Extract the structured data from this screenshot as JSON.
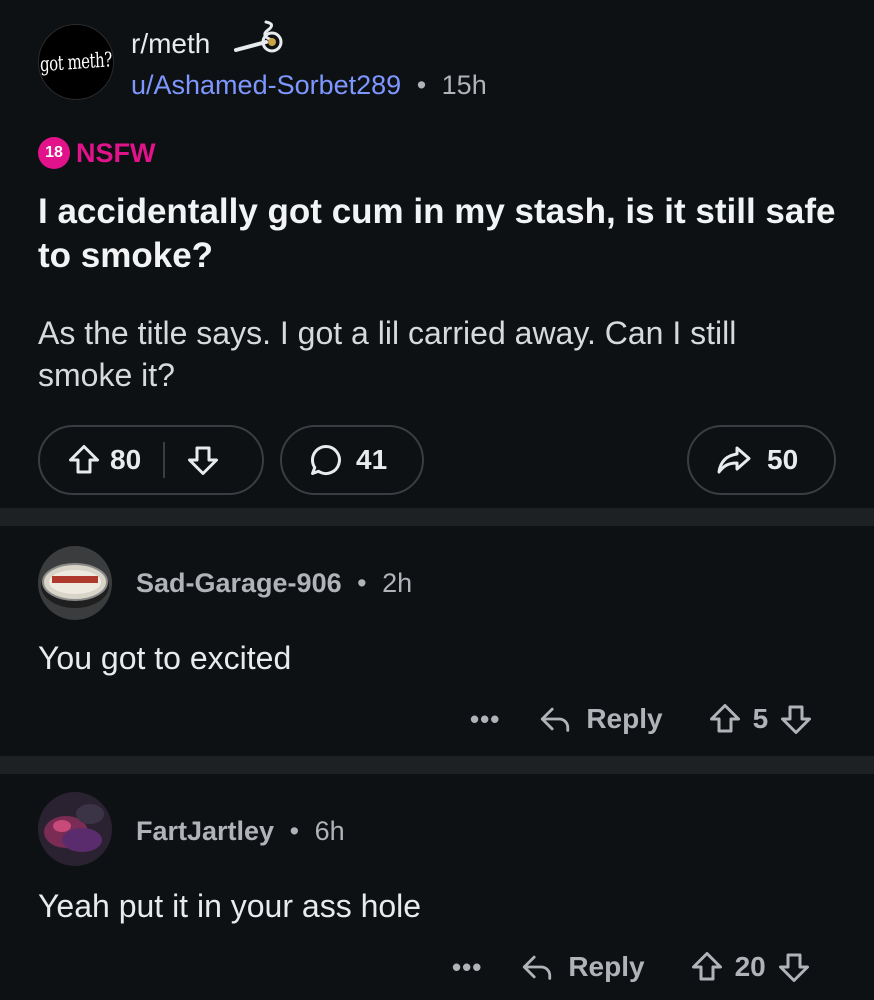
{
  "post": {
    "subreddit": "r/meth",
    "subreddit_avatar_text": "got meth?",
    "author": "u/Ashamed-Sorbet289",
    "separator": "•",
    "age": "15h",
    "nsfw_badge": "18",
    "nsfw_label": "NSFW",
    "title": "I accidentally got cum in my stash, is it still safe to smoke?",
    "body": "As the title says. I got a lil carried away. Can I still smoke it?",
    "upvotes": "80",
    "comments": "41",
    "shares": "50"
  },
  "comments": [
    {
      "username": "Sad-Garage-906",
      "separator": "•",
      "age": "2h",
      "text": "You got to excited",
      "more": "•••",
      "reply_label": "Reply",
      "votes": "5"
    },
    {
      "username": "FartJartley",
      "separator": "•",
      "age": "6h",
      "text": "Yeah put it in your ass hole",
      "more": "•••",
      "reply_label": "Reply",
      "votes": "20"
    }
  ],
  "colors": {
    "background": "#0e1113",
    "divider": "#1e2124",
    "author_link": "#7d97ff",
    "nsfw": "#e1128a",
    "secondary_text": "#b0b4b8"
  },
  "icons": [
    "upvote-icon",
    "downvote-icon",
    "comment-bubble-icon",
    "share-icon",
    "reply-icon",
    "more-options-icon"
  ]
}
